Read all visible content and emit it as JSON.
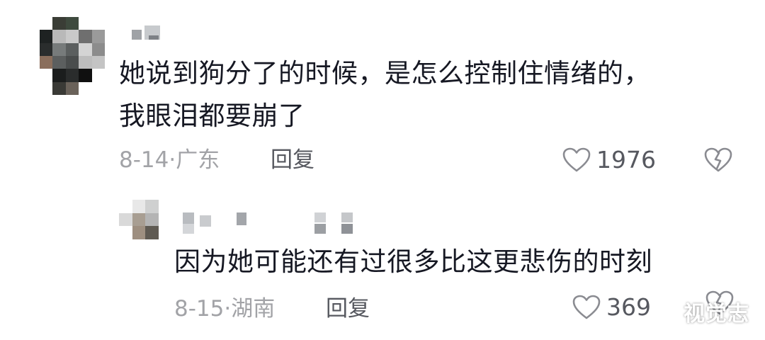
{
  "comment": {
    "text_line1": "她说到狗分了的时候，是怎么控制住情绪的，",
    "text_line2": "我眼泪都要崩了",
    "date": "8-14",
    "location": "广东",
    "reply_label": "回复",
    "like_count": "1976",
    "icons": {
      "like": "heart-icon",
      "dislike": "broken-heart-icon"
    }
  },
  "reply": {
    "text": "因为她可能还有过很多比这更悲伤的时刻",
    "date": "8-15",
    "location": "湖南",
    "reply_label": "回复",
    "like_count": "369",
    "icons": {
      "like": "heart-icon",
      "dislike": "broken-heart-icon"
    }
  },
  "watermark": "视觉志",
  "colors": {
    "text": "#161823",
    "meta": "#a2a3a7",
    "action": "#56585f",
    "icon": "#8a8b91"
  }
}
